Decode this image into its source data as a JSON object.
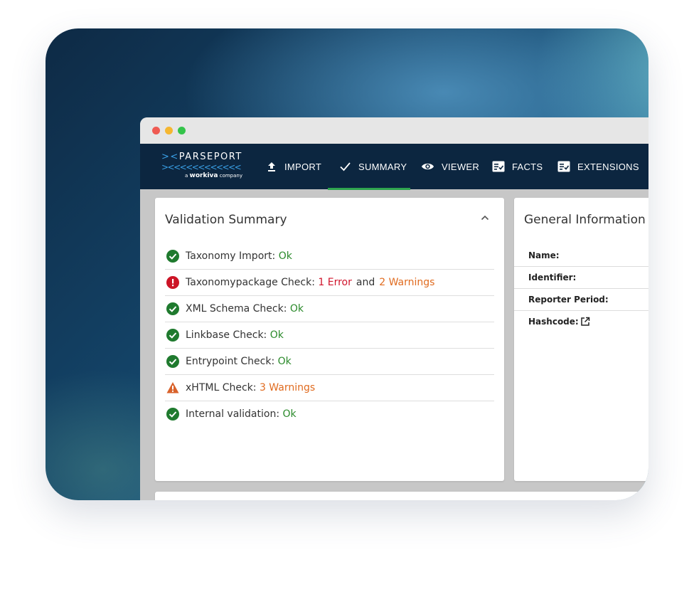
{
  "logo": {
    "brand": "PARSEPORT",
    "tagline_prefix": "a",
    "tagline_company": "workiva",
    "tagline_suffix": "company"
  },
  "nav": {
    "items": [
      {
        "label": "IMPORT",
        "icon": "upload-icon"
      },
      {
        "label": "SUMMARY",
        "icon": "checkmark-icon",
        "active": true
      },
      {
        "label": "VIEWER",
        "icon": "eye-icon"
      },
      {
        "label": "FACTS",
        "icon": "checklist-icon"
      },
      {
        "label": "EXTENSIONS",
        "icon": "checklist-icon"
      }
    ],
    "active_color": "#2ea44f",
    "background": "#0c2640"
  },
  "validation": {
    "title": "Validation Summary",
    "checks": [
      {
        "label": "Taxonomy Import:",
        "status": "ok",
        "parts": [
          "Ok"
        ]
      },
      {
        "label": "Taxonomypackage Check:",
        "status": "error",
        "parts": [
          "1 Error",
          "and",
          "2 Warnings"
        ]
      },
      {
        "label": "XML Schema Check:",
        "status": "ok",
        "parts": [
          "Ok"
        ]
      },
      {
        "label": "Linkbase Check:",
        "status": "ok",
        "parts": [
          "Ok"
        ]
      },
      {
        "label": "Entrypoint Check:",
        "status": "ok",
        "parts": [
          "Ok"
        ]
      },
      {
        "label": "xHTML Check:",
        "status": "warning",
        "parts": [
          "3 Warnings"
        ]
      },
      {
        "label": "Internal validation:",
        "status": "ok",
        "parts": [
          "Ok"
        ]
      }
    ]
  },
  "general": {
    "title": "General Information",
    "fields": [
      "Name:",
      "Identifier:",
      "Reporter Period:",
      "Hashcode:"
    ]
  },
  "colors": {
    "ok": "#2b8a2b",
    "error": "#d0152c",
    "warning": "#e06b1f"
  }
}
